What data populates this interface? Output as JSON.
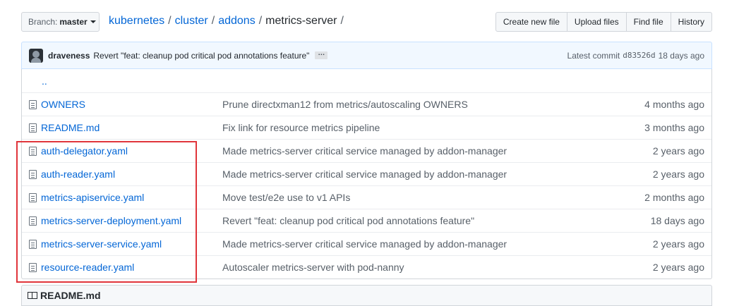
{
  "branch": {
    "label": "Branch:",
    "value": "master"
  },
  "breadcrumb": {
    "parts": [
      "kubernetes",
      "cluster",
      "addons"
    ],
    "current": "metrics-server",
    "separator": "/"
  },
  "actions": {
    "create": "Create new file",
    "upload": "Upload files",
    "find": "Find file",
    "history": "History"
  },
  "commit": {
    "author": "draveness",
    "message": "Revert \"feat: cleanup pod critical pod annotations feature\"",
    "ellipsis": "…",
    "latest_label": "Latest commit",
    "sha": "d83526d",
    "age": "18 days ago"
  },
  "parent_dir": "..",
  "files": [
    {
      "name": "OWNERS",
      "message": "Prune directxman12 from metrics/autoscaling OWNERS",
      "age": "4 months ago"
    },
    {
      "name": "README.md",
      "message": "Fix link for resource metrics pipeline",
      "age": "3 months ago"
    },
    {
      "name": "auth-delegator.yaml",
      "message": "Made metrics-server critical service managed by addon-manager",
      "age": "2 years ago"
    },
    {
      "name": "auth-reader.yaml",
      "message": "Made metrics-server critical service managed by addon-manager",
      "age": "2 years ago"
    },
    {
      "name": "metrics-apiservice.yaml",
      "message": "Move test/e2e use to v1 APIs",
      "age": "2 months ago"
    },
    {
      "name": "metrics-server-deployment.yaml",
      "message": "Revert \"feat: cleanup pod critical pod annotations feature\"",
      "age": "18 days ago"
    },
    {
      "name": "metrics-server-service.yaml",
      "message": "Made metrics-server critical service managed by addon-manager",
      "age": "2 years ago"
    },
    {
      "name": "resource-reader.yaml",
      "message": "Autoscaler metrics-server with pod-nanny",
      "age": "2 years ago"
    }
  ],
  "readme": {
    "title": "README.md"
  },
  "colors": {
    "link": "#0366d6",
    "highlight": "#e0353b",
    "commit_bg": "#f1f8ff"
  }
}
